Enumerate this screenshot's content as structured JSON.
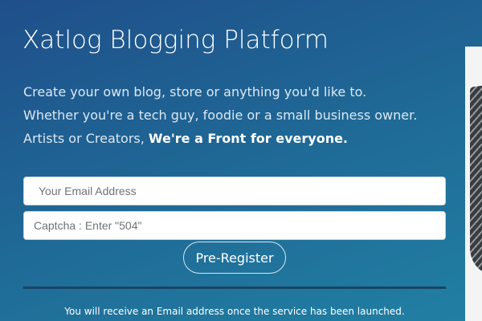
{
  "hero": {
    "title": "Xatlog Blogging Platform",
    "tagline_line1": "Create your own blog, store or anything you'd like to.",
    "tagline_line2": "Whether you're a tech guy, foodie or a small business owner.",
    "tagline_line3_prefix": "Artists or Creators, ",
    "tagline_line3_emphasis": "We're a Front for everyone."
  },
  "form": {
    "email_placeholder": "Your Email Address",
    "captcha_placeholder": "Captcha : Enter \"504\"",
    "submit_label": "Pre-Register"
  },
  "footer": {
    "notice": "You will receive an Email address once the service has been launched."
  },
  "side_image": {
    "icon": "laptop-keyboard-photo"
  },
  "colors": {
    "background_start": "#1f4f8a",
    "background_end": "#2180a3",
    "text": "#ffffff",
    "divider": "#184467"
  }
}
